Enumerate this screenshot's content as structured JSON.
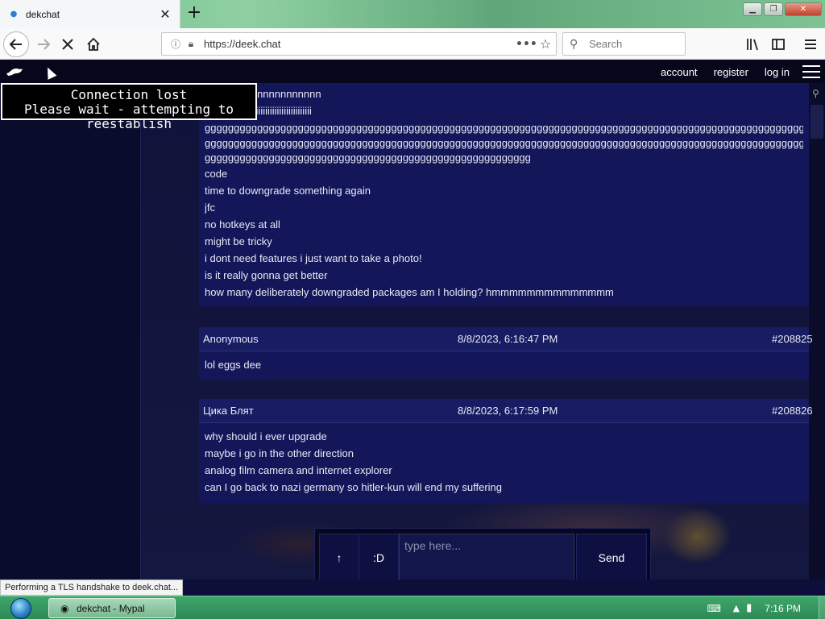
{
  "browser": {
    "tab_title": "dekchat",
    "tab_close": "✕",
    "new_tab": "+",
    "url": "https://deek.chat",
    "search_placeholder": "Search",
    "status_text": "Performing a TLS handshake to deek.chat..."
  },
  "site": {
    "nav": {
      "account": "account",
      "register": "register",
      "login": "log in"
    },
    "tooltip": {
      "line1": "Connection lost",
      "line2": "Please wait - attempting to reestablish"
    },
    "messages": [
      {
        "partial": true,
        "lines": [
          "nnnnnnnnnnnnnnnnnnnn",
          "iiiiiiiiiiiiiiiiiiiiiiiiiiiiiiiiiiiiiiiiiiiiii",
          "gggggggggggggggggggggggggggggggggggggggggggggggggggggggggggggggggggggggggggggggggggggggggggggggggggggggg",
          "gggggggggggggggggggggggggggggggggggggggggggggggggggggggggggggggggggggggggggggggggggggggggggggggggggggggg",
          "gggggggggggggggggggggggggggggggggggggggggggggggggggggggg",
          "code",
          "time to downgrade something again",
          "jfc",
          "no hotkeys at all",
          "might be tricky",
          "i dont need features i just want to take a photo!",
          "is it really gonna get better",
          "how many deliberately downgraded packages am I holding? hmmmmmmmmmmmmmm"
        ]
      },
      {
        "author": "Anonymous",
        "time": "8/8/2023, 6:16:47 PM",
        "number": "#208825",
        "lines": [
          "lol eggs dee"
        ]
      },
      {
        "author": "Цика Блят",
        "time": "8/8/2023, 6:17:59 PM",
        "number": "#208826",
        "lines": [
          "why should i ever upgrade",
          "maybe i go in the other direction",
          "analog film camera and internet explorer",
          "can I go back to nazi germany so hitler-kun will end my suffering"
        ]
      }
    ],
    "composer": {
      "up_label": "↑",
      "emoji_label": ":D",
      "placeholder": "type here...",
      "send_label": "Send"
    }
  },
  "taskbar": {
    "window_label": "dekchat - Mypal",
    "clock": "7:16 PM"
  },
  "icons": {
    "back": "arrow-left-icon",
    "forward": "arrow-right-icon",
    "stop": "close-icon",
    "home": "home-icon",
    "info": "info-icon",
    "lock": "lock-icon",
    "bookmark": "star-icon",
    "search": "search-icon",
    "library": "library-icon",
    "sidebar": "sidebar-icon",
    "menu": "hamburger-icon",
    "logo": "bird-logo-icon"
  },
  "colors": {
    "page_bg": "#0b0d32",
    "message_bg": "#13175a",
    "taskbar": "#3fa56b"
  }
}
